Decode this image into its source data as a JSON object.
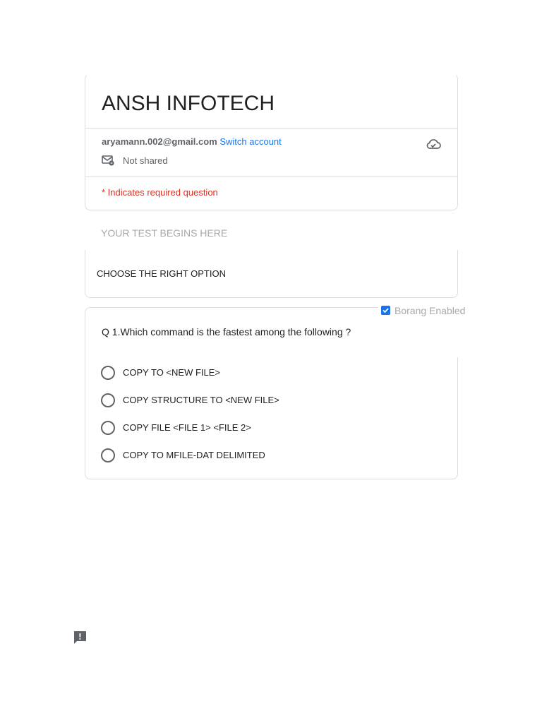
{
  "header": {
    "title": "ANSH INFOTECH",
    "account_email": "aryamann.002@gmail.com",
    "switch_account_label": "Switch account",
    "not_shared_label": "Not shared",
    "required_note": "* Indicates required question"
  },
  "section": {
    "title": "YOUR TEST BEGINS HERE",
    "description": "CHOOSE THE RIGHT OPTION"
  },
  "question": {
    "text": "Q 1.Which command is the fastest among the following ?",
    "options": [
      "COPY TO <NEW FILE>",
      "COPY STRUCTURE TO <NEW FILE>",
      "COPY FILE <FILE 1> <FILE 2>",
      "COPY TO MFILE-DAT DELIMITED"
    ]
  },
  "borang": {
    "label": "Borang Enabled",
    "checked": true
  },
  "colors": {
    "accent": "#1a73e8",
    "required": "#d93025",
    "muted": "#5f6368"
  },
  "icons": [
    "mail-lock-icon",
    "cloud-check-icon",
    "report-feedback-icon",
    "checkbox-check-icon"
  ]
}
